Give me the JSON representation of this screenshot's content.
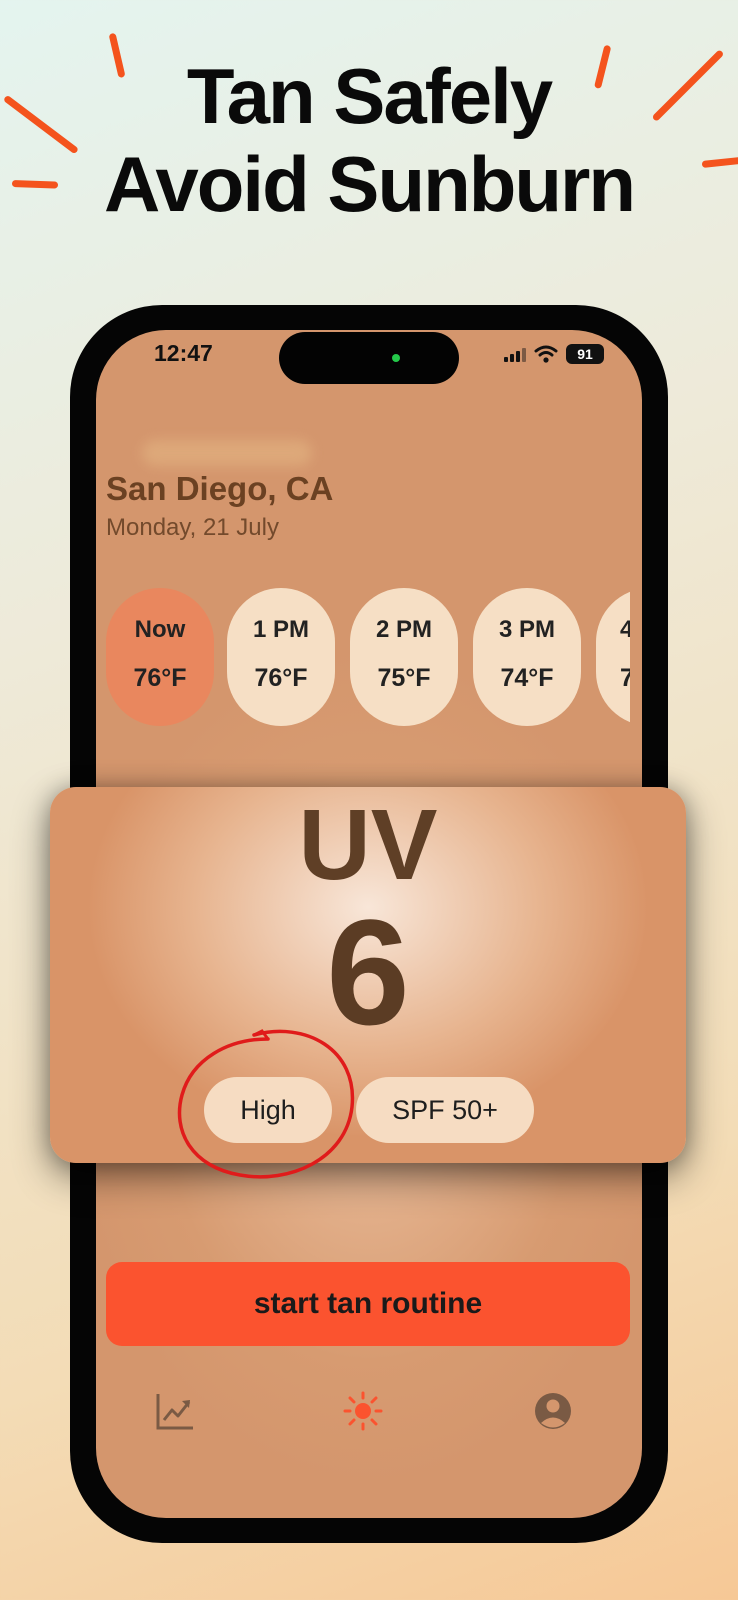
{
  "headline": {
    "line1": "Tan Safely",
    "line2": "Avoid Sunburn"
  },
  "status_bar": {
    "time": "12:47",
    "battery": "91"
  },
  "location": {
    "city": "San Diego, CA",
    "date": "Monday, 21 July"
  },
  "hourly": [
    {
      "label": "Now",
      "temp": "76°F"
    },
    {
      "label": "1 PM",
      "temp": "76°F"
    },
    {
      "label": "2 PM",
      "temp": "75°F"
    },
    {
      "label": "3 PM",
      "temp": "74°F"
    },
    {
      "label": "4",
      "temp": "7"
    }
  ],
  "uv": {
    "label": "UV",
    "value": "6",
    "risk": "High",
    "spf": "SPF 50+"
  },
  "cta": {
    "label": "start tan routine"
  },
  "bottom_nav": [
    {
      "icon": "chart-trend-icon",
      "active": false
    },
    {
      "icon": "sun-icon",
      "active": true
    },
    {
      "icon": "profile-icon",
      "active": false
    }
  ],
  "colors": {
    "accent": "#fb532f",
    "ray": "#f4531d",
    "pill_active": "#e9875e",
    "pill": "#f6dfc5",
    "text_brown": "#5b3c24",
    "annotation_red": "#e01b1b"
  }
}
